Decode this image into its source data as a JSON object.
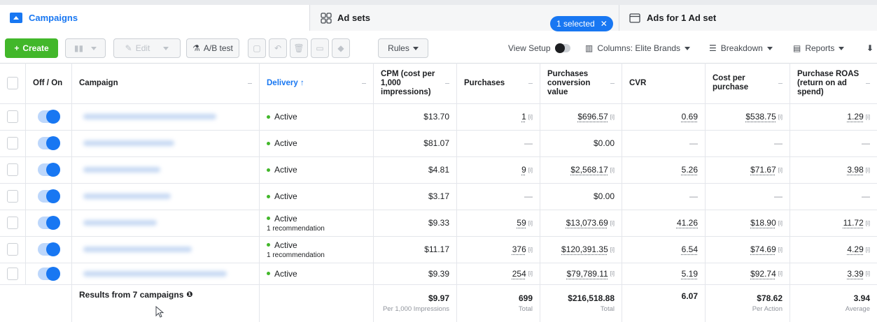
{
  "tabs": {
    "campaigns": "Campaigns",
    "ad_sets": "Ad sets",
    "selected_pill": "1 selected",
    "ads": "Ads for 1 Ad set"
  },
  "toolbar": {
    "create": "Create",
    "edit": "Edit",
    "ab_test": "A/B test",
    "rules": "Rules",
    "view_setup": "View Setup",
    "columns": "Columns: Elite Brands",
    "breakdown": "Breakdown",
    "reports": "Reports"
  },
  "table": {
    "headers": {
      "offon": "Off / On",
      "campaign": "Campaign",
      "delivery": "Delivery ↑",
      "cpm": "CPM (cost per 1,000 impressions)",
      "purchases": "Purchases",
      "conv_value": "Purchases conversion value",
      "cvr": "CVR",
      "cost_per_purchase": "Cost per purchase",
      "roas": "Purchase ROAS (return on ad spend)"
    },
    "rows": [
      {
        "delivery": "Active",
        "recommendation": "",
        "cpm": "$13.70",
        "purchases": "1",
        "conv_value": "$696.57",
        "cvr": "0.69",
        "cost": "$538.75",
        "roas": "1.29"
      },
      {
        "delivery": "Active",
        "recommendation": "",
        "cpm": "$81.07",
        "purchases": "—",
        "conv_value": "$0.00",
        "cvr": "—",
        "cost": "—",
        "roas": "—"
      },
      {
        "delivery": "Active",
        "recommendation": "",
        "cpm": "$4.81",
        "purchases": "9",
        "conv_value": "$2,568.17",
        "cvr": "5.26",
        "cost": "$71.67",
        "roas": "3.98"
      },
      {
        "delivery": "Active",
        "recommendation": "",
        "cpm": "$3.17",
        "purchases": "—",
        "conv_value": "$0.00",
        "cvr": "—",
        "cost": "—",
        "roas": "—"
      },
      {
        "delivery": "Active",
        "recommendation": "1 recommendation",
        "cpm": "$9.33",
        "purchases": "59",
        "conv_value": "$13,073.69",
        "cvr": "41.26",
        "cost": "$18.90",
        "roas": "11.72"
      },
      {
        "delivery": "Active",
        "recommendation": "1 recommendation",
        "cpm": "$11.17",
        "purchases": "376",
        "conv_value": "$120,391.35",
        "cvr": "6.54",
        "cost": "$74.69",
        "roas": "4.29"
      },
      {
        "delivery": "Active",
        "recommendation": "",
        "cpm": "$9.39",
        "purchases": "254",
        "conv_value": "$79,789.11",
        "cvr": "5.19",
        "cost": "$92.74",
        "roas": "3.39"
      }
    ],
    "footer": {
      "results": "Results from 7 campaigns",
      "cpm": "$9.97",
      "cpm_sub": "Per 1,000 Impressions",
      "purchases": "699",
      "purchases_sub": "Total",
      "conv_value": "$216,518.88",
      "conv_value_sub": "Total",
      "cvr": "6.07",
      "cost": "$78.62",
      "cost_sub": "Per Action",
      "roas": "3.94",
      "roas_sub": "Average"
    }
  },
  "colors": {
    "accent": "#1877f2",
    "create": "#42b72a",
    "active_dot": "#42b72a"
  }
}
